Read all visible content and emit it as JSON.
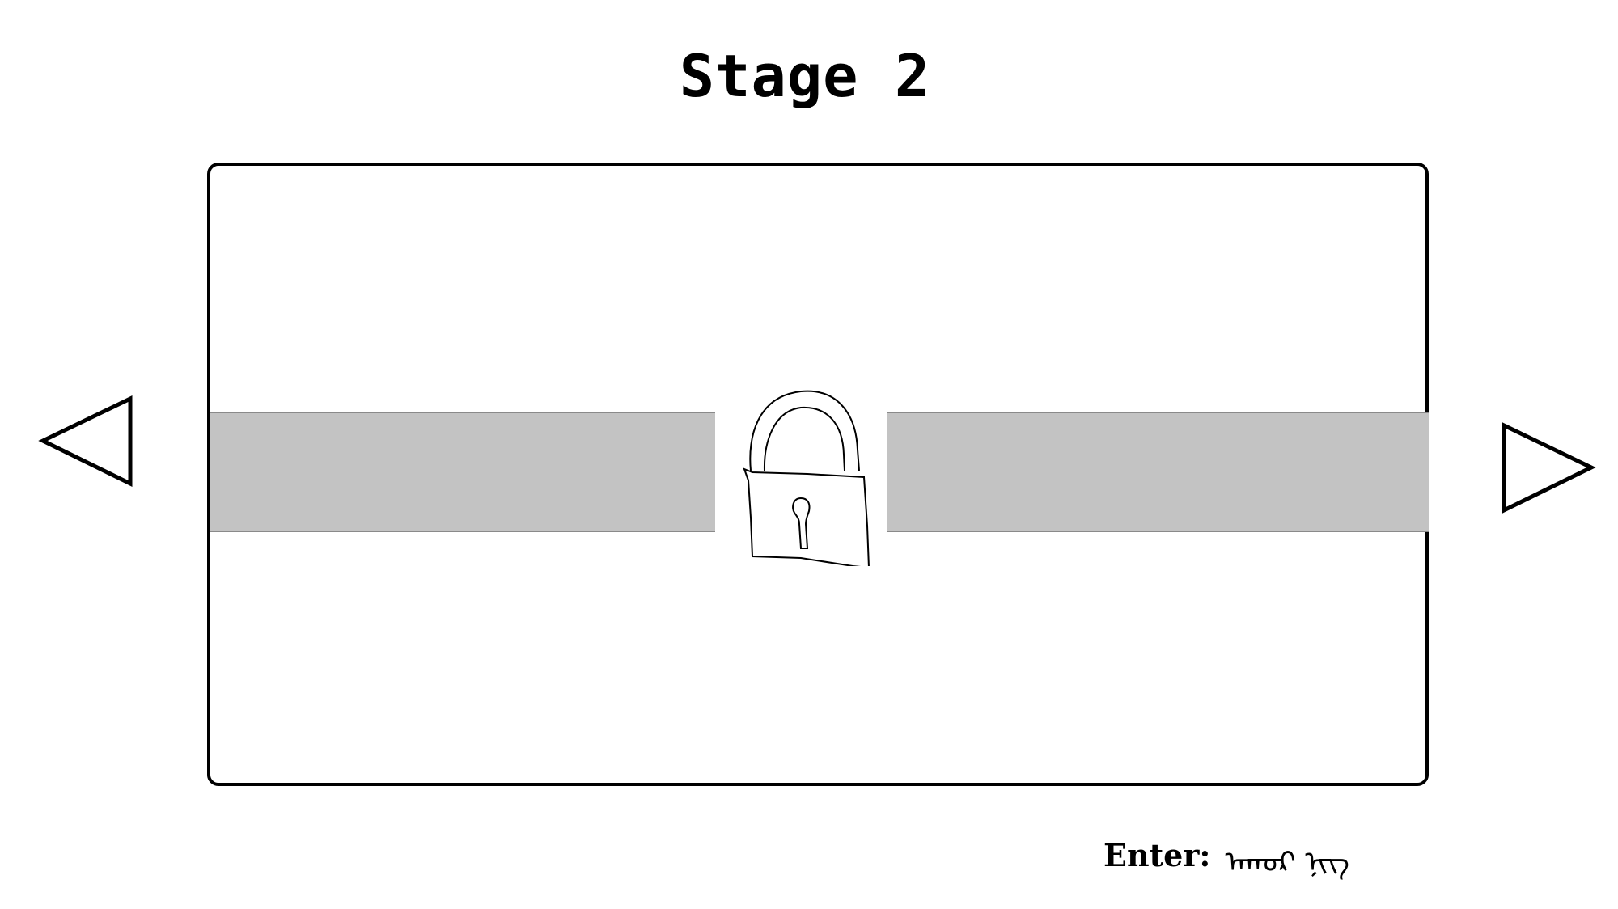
{
  "stage": {
    "title": "Stage 2"
  },
  "panel": {
    "lock_icon": "padlock-icon",
    "track_color": "#c3c3c3"
  },
  "navigation": {
    "prev_icon": "triangle-left-icon",
    "next_icon": "triangle-right-icon"
  },
  "input": {
    "label": "Enter:",
    "value": "ᠠᠬᠣᠷ ᠨᠢᠭ"
  }
}
